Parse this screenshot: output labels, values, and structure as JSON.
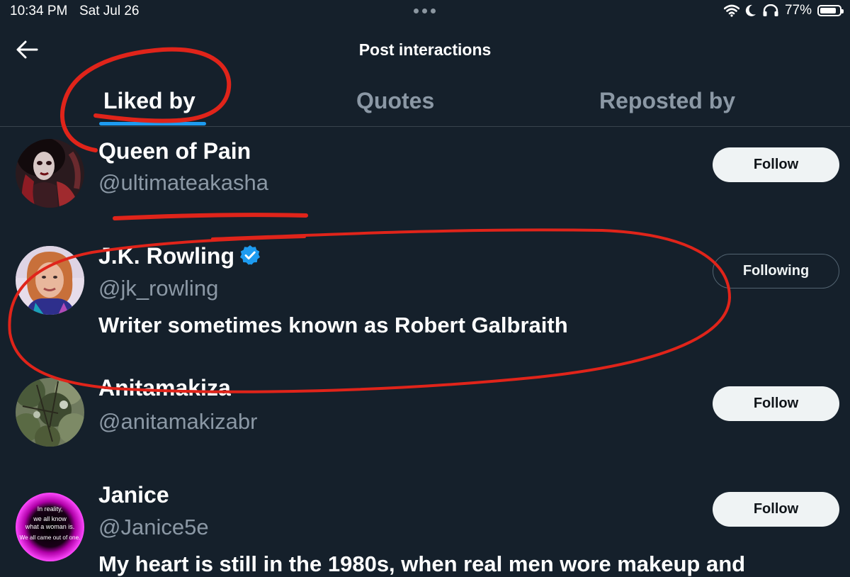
{
  "status_bar": {
    "time": "10:34 PM",
    "date": "Sat Jul 26",
    "battery": "77%"
  },
  "header": {
    "title": "Post interactions",
    "back_icon": "arrow-left-icon"
  },
  "tabs": [
    {
      "label": "Liked by",
      "active": true
    },
    {
      "label": "Quotes",
      "active": false
    },
    {
      "label": "Reposted by",
      "active": false
    }
  ],
  "users": [
    {
      "name": "Queen of Pain",
      "handle": "@ultimateakasha",
      "button": "Follow"
    },
    {
      "name": "J.K. Rowling",
      "handle": "@jk_rowling",
      "verified": true,
      "bio": "Writer sometimes known as Robert Galbraith",
      "button": "Following"
    },
    {
      "name": "Anitamakiza",
      "handle": "@anitamakizabr",
      "button": "Follow"
    },
    {
      "name": "Janice",
      "handle": "@Janice5e",
      "bio": "My heart is still in the 1980s, when real men wore makeup and",
      "button": "Follow",
      "avatar_text": [
        "In reality,",
        "we all know",
        "what a woman is.",
        "We all came out of one."
      ]
    }
  ],
  "colors": {
    "background": "#15202b",
    "accent": "#1d9bf0",
    "annotation": "#e0241a"
  }
}
